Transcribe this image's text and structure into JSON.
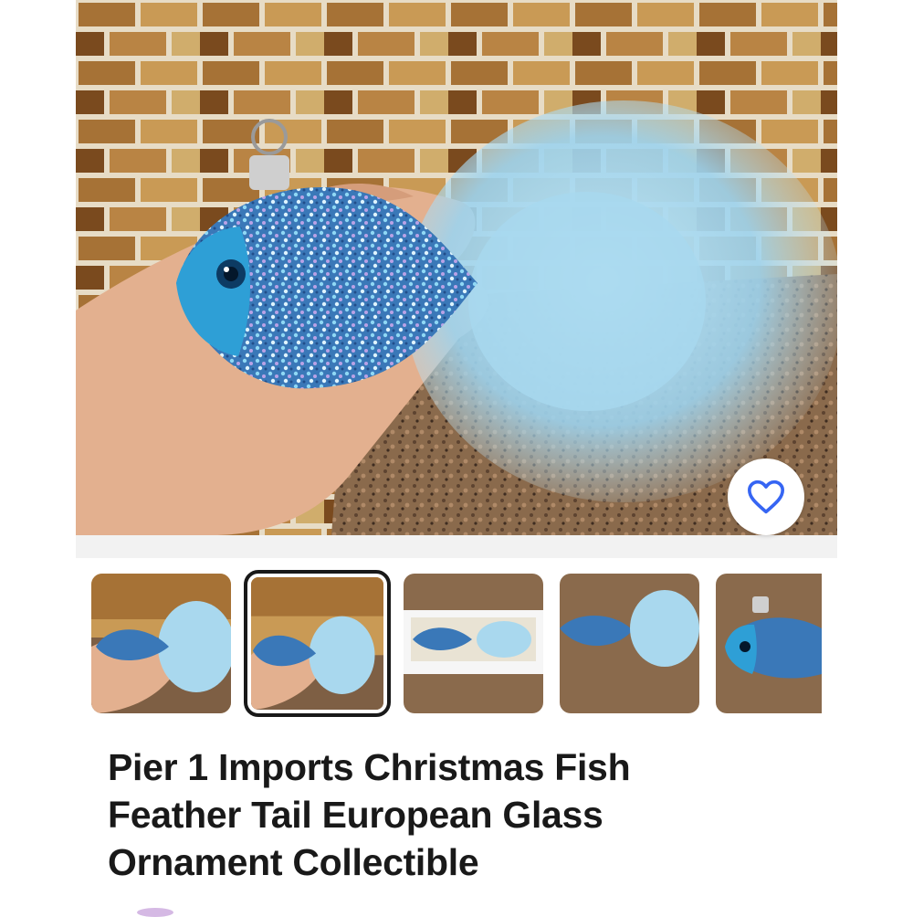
{
  "listing": {
    "title": "Pier 1 Imports Christmas Fish Feather Tail European Glass Ornament Collectible"
  },
  "gallery": {
    "main_image_alt": "Blue glitter glass fish ornament with light blue feather tail held in hand",
    "favorite_icon": "heart-outline-icon",
    "selected_index": 1,
    "thumbnails": [
      {
        "view": "fish-in-hand-left"
      },
      {
        "view": "fish-in-hand-selected"
      },
      {
        "view": "fish-in-box"
      },
      {
        "view": "fish-on-counter"
      },
      {
        "view": "fish-face-closeup"
      }
    ]
  },
  "colors": {
    "accent_blue": "#3665f3",
    "text": "#191919",
    "fish_blue": "#2aa3d8",
    "feather": "#a9d8ee"
  }
}
